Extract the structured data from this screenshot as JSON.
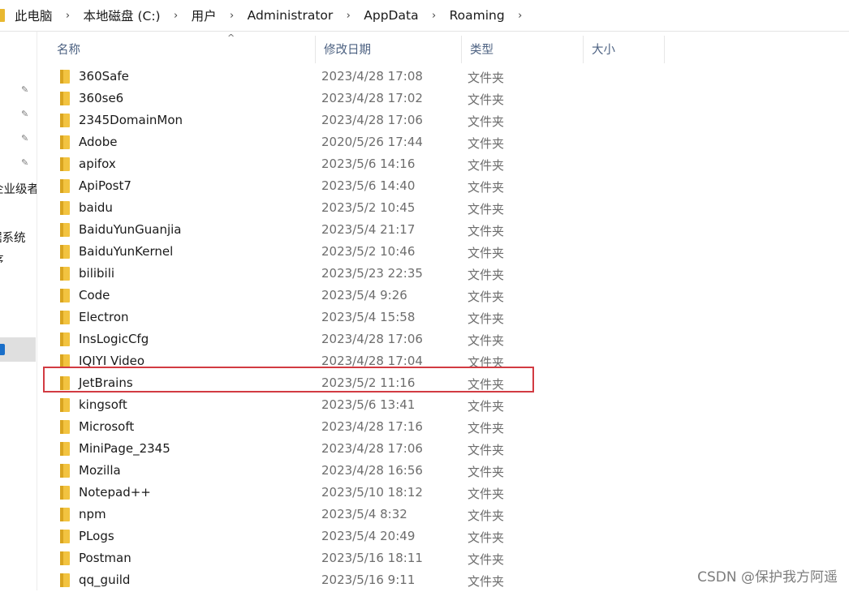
{
  "breadcrumb": {
    "segments": [
      "此电脑",
      "本地磁盘 (C:)",
      "用户",
      "Administrator",
      "AppData",
      "Roaming"
    ],
    "separator": "›"
  },
  "nav": {
    "truncated_labels": [
      "企业级者",
      "据系统",
      "序"
    ]
  },
  "columns": {
    "name": "名称",
    "date": "修改日期",
    "type": "类型",
    "size": "大小",
    "sort_indicator": "^"
  },
  "files": [
    {
      "name": "360Safe",
      "date": "2023/4/28 17:08",
      "type": "文件夹"
    },
    {
      "name": "360se6",
      "date": "2023/4/28 17:02",
      "type": "文件夹"
    },
    {
      "name": "2345DomainMon",
      "date": "2023/4/28 17:06",
      "type": "文件夹"
    },
    {
      "name": "Adobe",
      "date": "2020/5/26 17:44",
      "type": "文件夹"
    },
    {
      "name": "apifox",
      "date": "2023/5/6 14:16",
      "type": "文件夹"
    },
    {
      "name": "ApiPost7",
      "date": "2023/5/6 14:40",
      "type": "文件夹"
    },
    {
      "name": "baidu",
      "date": "2023/5/2 10:45",
      "type": "文件夹"
    },
    {
      "name": "BaiduYunGuanjia",
      "date": "2023/5/4 21:17",
      "type": "文件夹"
    },
    {
      "name": "BaiduYunKernel",
      "date": "2023/5/2 10:46",
      "type": "文件夹"
    },
    {
      "name": "bilibili",
      "date": "2023/5/23 22:35",
      "type": "文件夹"
    },
    {
      "name": "Code",
      "date": "2023/5/4 9:26",
      "type": "文件夹"
    },
    {
      "name": "Electron",
      "date": "2023/5/4 15:58",
      "type": "文件夹"
    },
    {
      "name": "InsLogicCfg",
      "date": "2023/4/28 17:06",
      "type": "文件夹"
    },
    {
      "name": "IQIYI Video",
      "date": "2023/4/28 17:04",
      "type": "文件夹"
    },
    {
      "name": "JetBrains",
      "date": "2023/5/2 11:16",
      "type": "文件夹"
    },
    {
      "name": "kingsoft",
      "date": "2023/5/6 13:41",
      "type": "文件夹"
    },
    {
      "name": "Microsoft",
      "date": "2023/4/28 17:16",
      "type": "文件夹"
    },
    {
      "name": "MiniPage_2345",
      "date": "2023/4/28 17:06",
      "type": "文件夹"
    },
    {
      "name": "Mozilla",
      "date": "2023/4/28 16:56",
      "type": "文件夹"
    },
    {
      "name": "Notepad++",
      "date": "2023/5/10 18:12",
      "type": "文件夹"
    },
    {
      "name": "npm",
      "date": "2023/5/4 8:32",
      "type": "文件夹"
    },
    {
      "name": "PLogs",
      "date": "2023/5/4 20:49",
      "type": "文件夹"
    },
    {
      "name": "Postman",
      "date": "2023/5/16 18:11",
      "type": "文件夹"
    },
    {
      "name": "qq_guild",
      "date": "2023/5/16 9:11",
      "type": "文件夹"
    }
  ],
  "highlighted_item": "JetBrains",
  "watermark": "CSDN @保护我方阿遥",
  "colors": {
    "folder": "#f2c340",
    "highlight_border": "#d23b42",
    "header_text": "#4d6282",
    "nav_selected_bg": "#dfdfdf"
  }
}
